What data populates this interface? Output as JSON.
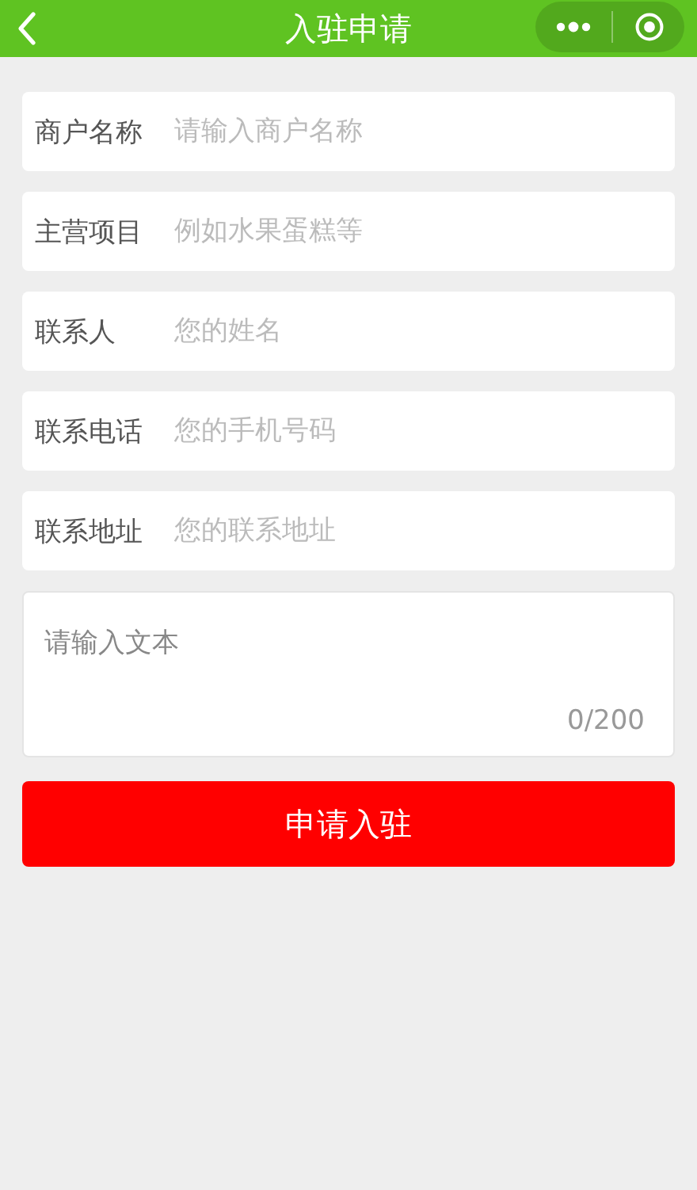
{
  "header": {
    "title": "入驻申请"
  },
  "fields": [
    {
      "label": "商户名称",
      "placeholder": "请输入商户名称"
    },
    {
      "label": "主营项目",
      "placeholder": "例如水果蛋糕等"
    },
    {
      "label": "联系人",
      "placeholder": "您的姓名"
    },
    {
      "label": "联系电话",
      "placeholder": "您的手机号码"
    },
    {
      "label": "联系地址",
      "placeholder": "您的联系地址"
    }
  ],
  "textarea": {
    "placeholder": "请输入文本",
    "counter": "0/200"
  },
  "submit_button": "申请入驻"
}
